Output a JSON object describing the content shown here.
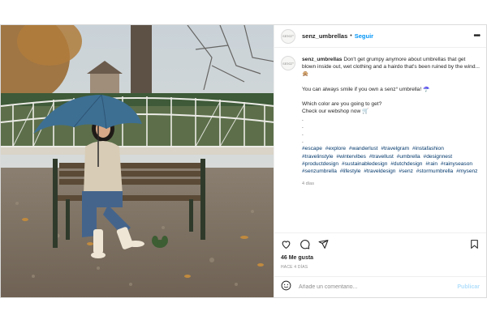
{
  "post": {
    "username": "senz_umbrellas",
    "follow_label": "Seguir",
    "avatar_text": "SENZ°",
    "separator": "•",
    "caption": {
      "username": "senz_umbrellas",
      "line1": "Don't get grumpy anymore about umbrellas that get blown inside out, wet clothing and a hairdo that's been ruined by the wind... 🙊",
      "line2": "You can always smile if you own a senz° umbrella! ☂️",
      "line3": "Which color are you going to get?",
      "line4": "Check our webshop now 🛒",
      "dots": [
        ".",
        ".",
        ".",
        "."
      ],
      "hashtags": [
        "#escape",
        "#explore",
        "#wanderlust",
        "#travelgram",
        "#instafashion",
        "#travelinstyle",
        "#wintervibes",
        "#travellust",
        "#umbrella",
        "#designnest",
        "#productdesign",
        "#sustainabledesign",
        "#dutchdesign",
        "#rain",
        "#rainyseason",
        "#senzumbrella",
        "#lifestyle",
        "#traveldesign",
        "#senz",
        "#stormumbrella",
        "#mysenz"
      ],
      "time_ago": "4 días"
    },
    "likes": "46 Me gusta",
    "date": "HACE 4 DÍAS",
    "comment_placeholder": "Añade un comentario...",
    "publish_label": "Publicar"
  },
  "icons": {
    "more": "more-dots-icon",
    "like": "heart-icon",
    "comment": "comment-icon",
    "share": "send-icon",
    "save": "bookmark-icon",
    "emoji": "emoji-icon"
  },
  "colors": {
    "accent": "#0095f6",
    "hashtag": "#00376b",
    "muted": "#8e8e8e",
    "publish_disabled": "#b2dffc",
    "umbrella": "#3d6f93"
  }
}
